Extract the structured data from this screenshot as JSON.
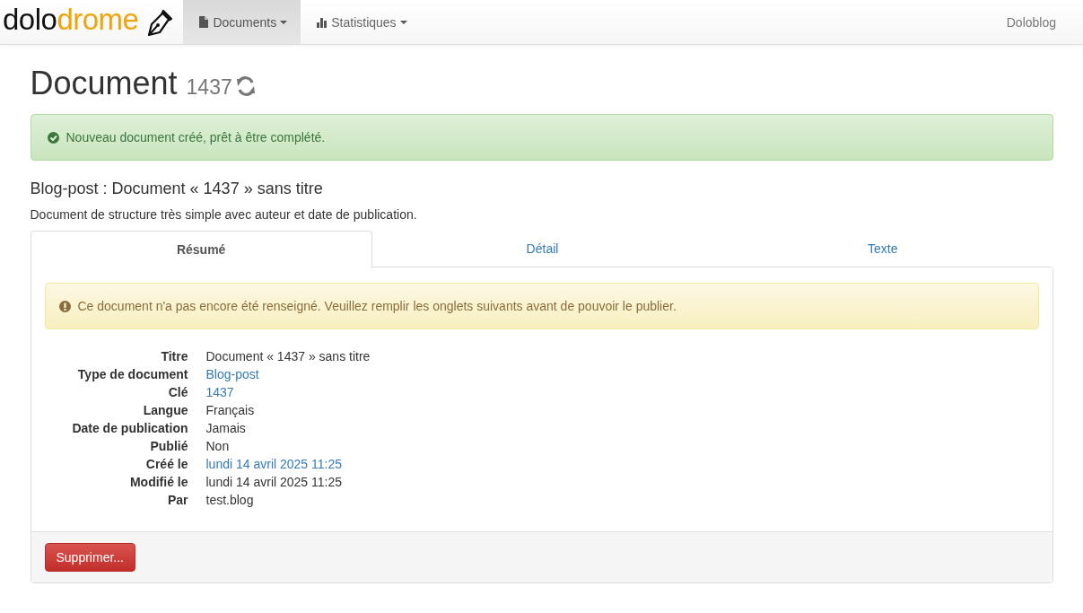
{
  "navbar": {
    "logo": {
      "first": "dolo",
      "second": "drome"
    },
    "menus": [
      {
        "label": "Documents",
        "kind": "file",
        "selected": true
      },
      {
        "label": "Statistiques",
        "kind": "chart",
        "selected": false
      }
    ],
    "right_link": "Doloblog"
  },
  "header": {
    "title": "Document",
    "number": "1437"
  },
  "success_alert": "Nouveau document créé, prêt à être complété.",
  "subtitle": "Blog-post : Document « 1437 » sans titre",
  "description": "Document de structure très simple avec auteur et date de publication.",
  "tabs": [
    {
      "label": "Résumé",
      "selected": true
    },
    {
      "label": "Détail",
      "selected": false
    },
    {
      "label": "Texte",
      "selected": false
    }
  ],
  "warning_alert": "Ce document n'a pas encore été renseigné. Veuillez remplir les onglets suivants avant de pouvoir le publier.",
  "details": [
    {
      "label": "Titre",
      "value": "Document « 1437 » sans titre",
      "link": false
    },
    {
      "label": "Type de document",
      "value": "Blog-post",
      "link": true
    },
    {
      "label": "Clé",
      "value": "1437",
      "link": true
    },
    {
      "label": "Langue",
      "value": "Français",
      "link": false
    },
    {
      "label": "Date de publication",
      "value": "Jamais",
      "link": false
    },
    {
      "label": "Publié",
      "value": "Non",
      "link": false
    },
    {
      "label": "Créé le",
      "value": "lundi 14 avril 2025 11:25",
      "link": true
    },
    {
      "label": "Modifié le",
      "value": "lundi 14 avril 2025 11:25",
      "link": false
    },
    {
      "label": "Par",
      "value": "test.blog",
      "link": false
    }
  ],
  "delete_button": "Supprimer..."
}
